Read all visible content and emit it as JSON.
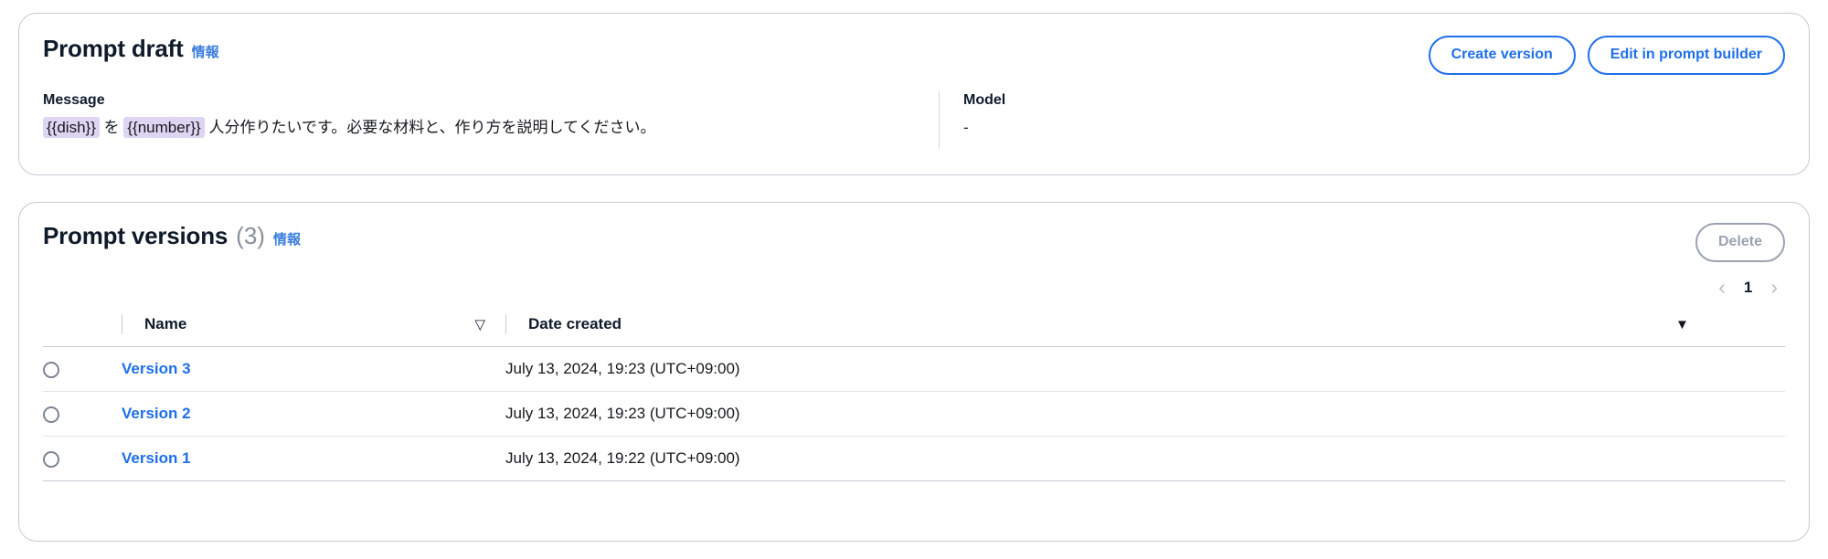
{
  "draft_card": {
    "title": "Prompt draft",
    "info_label": "情報",
    "buttons": {
      "create_version": "Create version",
      "edit_in_prompt_builder": "Edit in prompt builder"
    },
    "message": {
      "label": "Message",
      "segments": [
        {
          "kind": "variable",
          "text": "{{dish}}"
        },
        {
          "kind": "text",
          "text": " を "
        },
        {
          "kind": "variable",
          "text": "{{number}}"
        },
        {
          "kind": "text",
          "text": " 人分作りたいです。必要な材料と、作り方を説明してください。"
        }
      ],
      "full_text": "{{dish}} を {{number}} 人分作りたいです。必要な材料と、作り方を説明してください。"
    },
    "model": {
      "label": "Model",
      "value": "-"
    }
  },
  "versions_card": {
    "title": "Prompt versions",
    "count": "(3)",
    "info_label": "情報",
    "delete_button": "Delete",
    "pagination": {
      "prev_icon": "‹",
      "page": "1",
      "next_icon": "›"
    },
    "table": {
      "columns": {
        "name": "Name",
        "date_created": "Date created"
      },
      "sort_icon": "▽",
      "preferences_icon": "▼",
      "rows": [
        {
          "radio": "unselected",
          "name": "Version 3",
          "date_created": "July 13, 2024, 19:23 (UTC+09:00)"
        },
        {
          "radio": "unselected",
          "name": "Version 2",
          "date_created": "July 13, 2024, 19:23 (UTC+09:00)"
        },
        {
          "radio": "unselected",
          "name": "Version 1",
          "date_created": "July 13, 2024, 19:22 (UTC+09:00)"
        }
      ]
    }
  },
  "colors": {
    "accent_blue": "#1f6feb",
    "link_blue": "#3b7ddd",
    "variable_chip_bg": "#ded5f2",
    "border_gray": "#c6c9d2",
    "disabled_gray": "#9ba2b0",
    "text_dark": "#0f1b2a"
  }
}
